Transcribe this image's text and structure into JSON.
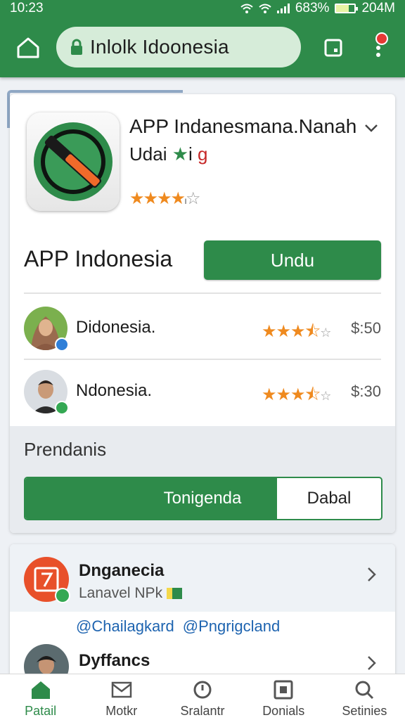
{
  "status_bar": {
    "time": "10:23",
    "battery": "683%",
    "right_extra": "204M",
    "battery_level": 0.68
  },
  "browser": {
    "url": "Inlolk Idoonesia",
    "icons": [
      "home-icon",
      "lock-icon",
      "tabs-icon",
      "more-vert-icon"
    ]
  },
  "app": {
    "title": "APP Indanesmana.Nanah",
    "subtitle_prefix": "Udai",
    "subtitle_i": "i",
    "subtitle_g": "g",
    "rating": 4,
    "rating_suffix": "ı",
    "name": "APP Indonesia",
    "download_label": "Undu"
  },
  "reviews": [
    {
      "name": "Didonesia.",
      "rating": 3.5,
      "price": "$:50",
      "badge_color": "#2f7fd8"
    },
    {
      "name": "Ndonesia.",
      "rating": 3.5,
      "price": "$:30",
      "badge_color": "#34a853"
    }
  ],
  "section": {
    "title": "Prendanis",
    "segments": [
      "Tonigenda",
      "Dabal"
    ],
    "active_segment": 0
  },
  "list": [
    {
      "title": "Dnganecia",
      "subtitle": "Lanavel NPk"
    },
    {
      "title": "Dyffancs"
    }
  ],
  "tags": [
    "@Chailagkard",
    "@Pngrigcland"
  ],
  "bottom_nav": [
    {
      "label": "Patail",
      "icon": "home-icon"
    },
    {
      "label": "Motkr",
      "icon": "mail-icon"
    },
    {
      "label": "Sralantr",
      "icon": "clock-icon"
    },
    {
      "label": "Donials",
      "icon": "box-icon"
    },
    {
      "label": "Setinies",
      "icon": "search-icon"
    }
  ],
  "colors": {
    "brand": "#2e8b4a",
    "star": "#ef8a1f",
    "link": "#1e64b0"
  }
}
